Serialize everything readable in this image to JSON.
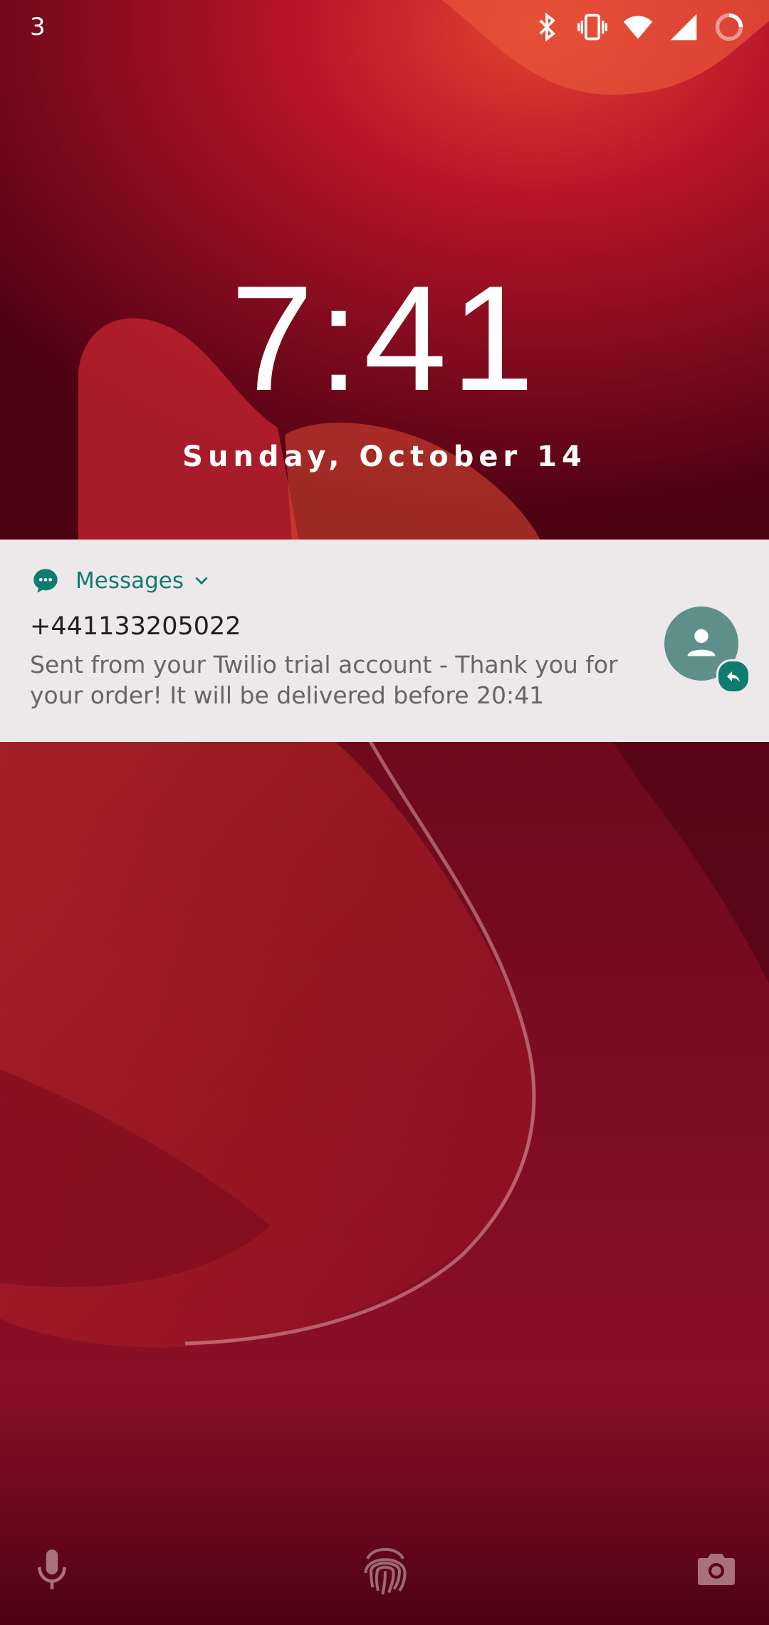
{
  "status_bar": {
    "notification_count": "3",
    "icons": [
      "bluetooth-icon",
      "vibrate-icon",
      "wifi-icon",
      "cell-signal-icon",
      "battery-icon"
    ]
  },
  "lockscreen": {
    "time": "7:41",
    "date": "Sunday, October 14"
  },
  "notification": {
    "app_name": "Messages",
    "sender": "+441133205022",
    "message": "Sent from your Twilio trial account - Thank you for your order! It will be delivered before 20:41",
    "accent_color": "#0e7d70"
  },
  "bottom_shortcuts": [
    "mic-icon",
    "fingerprint-icon",
    "camera-icon"
  ]
}
